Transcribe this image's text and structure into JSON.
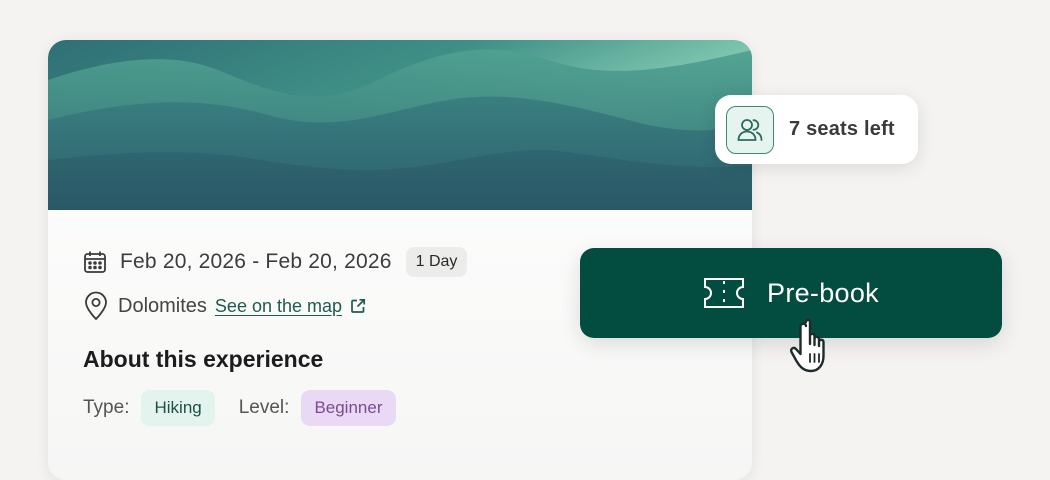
{
  "event": {
    "date_range": "Feb 20, 2026 - Feb 20, 2026",
    "duration_badge": "1 Day",
    "location": "Dolomites",
    "map_link": "See on the map"
  },
  "about": {
    "title": "About this experience",
    "type_label": "Type:",
    "type_value": "Hiking",
    "level_label": "Level:",
    "level_value": "Beginner"
  },
  "availability": {
    "seats_text": "7 seats left"
  },
  "actions": {
    "prebook_label": "Pre-book"
  },
  "colors": {
    "primary": "#024c40",
    "type_tag_bg": "#e3f3ee",
    "level_tag_bg": "#ead9f4",
    "link": "#1f5a50"
  },
  "icons": {
    "date": "calendar-icon",
    "location": "map-pin-icon",
    "external": "external-link-icon",
    "seats": "users-icon",
    "prebook": "ticket-icon",
    "pointer": "hand-cursor-icon"
  }
}
